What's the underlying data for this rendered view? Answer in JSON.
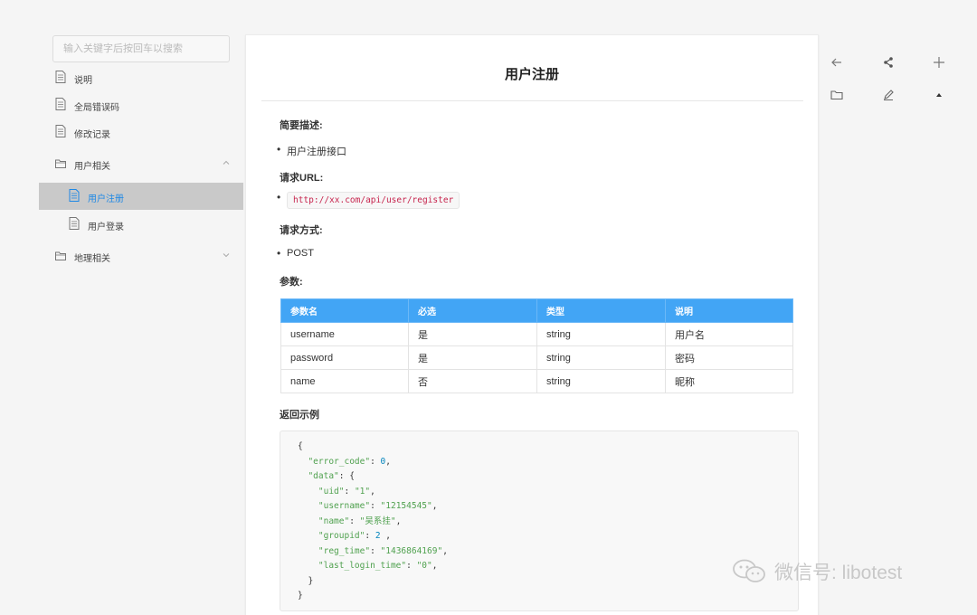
{
  "sidebar": {
    "search_placeholder": "输入关键字后按回车以搜索",
    "items": [
      {
        "label": "说明"
      },
      {
        "label": "全局错误码"
      },
      {
        "label": "修改记录"
      },
      {
        "label": "用户相关"
      },
      {
        "label": "用户注册"
      },
      {
        "label": "用户登录"
      },
      {
        "label": "地理相关"
      }
    ]
  },
  "doc": {
    "title": "用户注册",
    "summary_heading": "简要描述:",
    "summary_text": "用户注册接口",
    "url_heading": "请求URL:",
    "url_value": "http://xx.com/api/user/register",
    "method_heading": "请求方式:",
    "method_value": "POST",
    "params_heading": "参数:",
    "table": {
      "headers": [
        "参数名",
        "必选",
        "类型",
        "说明"
      ],
      "rows": [
        [
          "username",
          "是",
          "string",
          "用户名"
        ],
        [
          "password",
          "是",
          "string",
          "密码"
        ],
        [
          "name",
          "否",
          "string",
          "昵称"
        ]
      ]
    },
    "return_heading": "返回示例",
    "code": {
      "l1": "{",
      "error_code_key": "\"error_code\"",
      "error_code_val": "0",
      "data_key": "\"data\"",
      "uid_key": "\"uid\"",
      "uid_val": "\"1\"",
      "username_key": "\"username\"",
      "username_val": "\"12154545\"",
      "name_key": "\"name\"",
      "name_val": "\"吴系挂\"",
      "groupid_key": "\"groupid\"",
      "groupid_val": "2",
      "reg_time_key": "\"reg_time\"",
      "reg_time_val": "\"1436864169\"",
      "last_login_key": "\"last_login_time\"",
      "last_login_val": "\"0\"",
      "inner_close": "}",
      "outer_close": "}"
    }
  },
  "watermark": "微信号: libotest",
  "colors": {
    "accent": "#42a5f5",
    "active_link": "#1e88e5",
    "code_url": "#c7254e"
  }
}
